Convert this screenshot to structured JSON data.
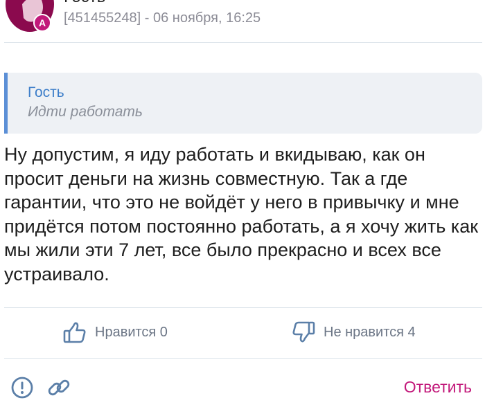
{
  "post": {
    "author_avatar_letter": "A",
    "author_name_partial": "Гость",
    "meta": "[451455248] - 06 ноября, 16:25"
  },
  "quote": {
    "author": "Гость",
    "text": "Идти работать"
  },
  "body": "Ну допустим, я иду работать и вкидываю, как он просит деньги на жизнь совместную. Так а где гарантии, что это не войдёт у него в привычку и мне придётся потом постоянно работать, а я хочу жить как мы жили эти 7 лет, все было прекрасно и всех все устраивало.",
  "reactions": {
    "like_label": "Нравится 0",
    "dislike_label": "Не нравится 4"
  },
  "actions": {
    "reply_label": "Ответить"
  },
  "colors": {
    "accent": "#c2187a",
    "quote_border": "#5b8fd6",
    "quote_author": "#3d7ec9"
  },
  "icons": [
    "like-icon",
    "dislike-icon",
    "report-icon",
    "link-icon"
  ]
}
